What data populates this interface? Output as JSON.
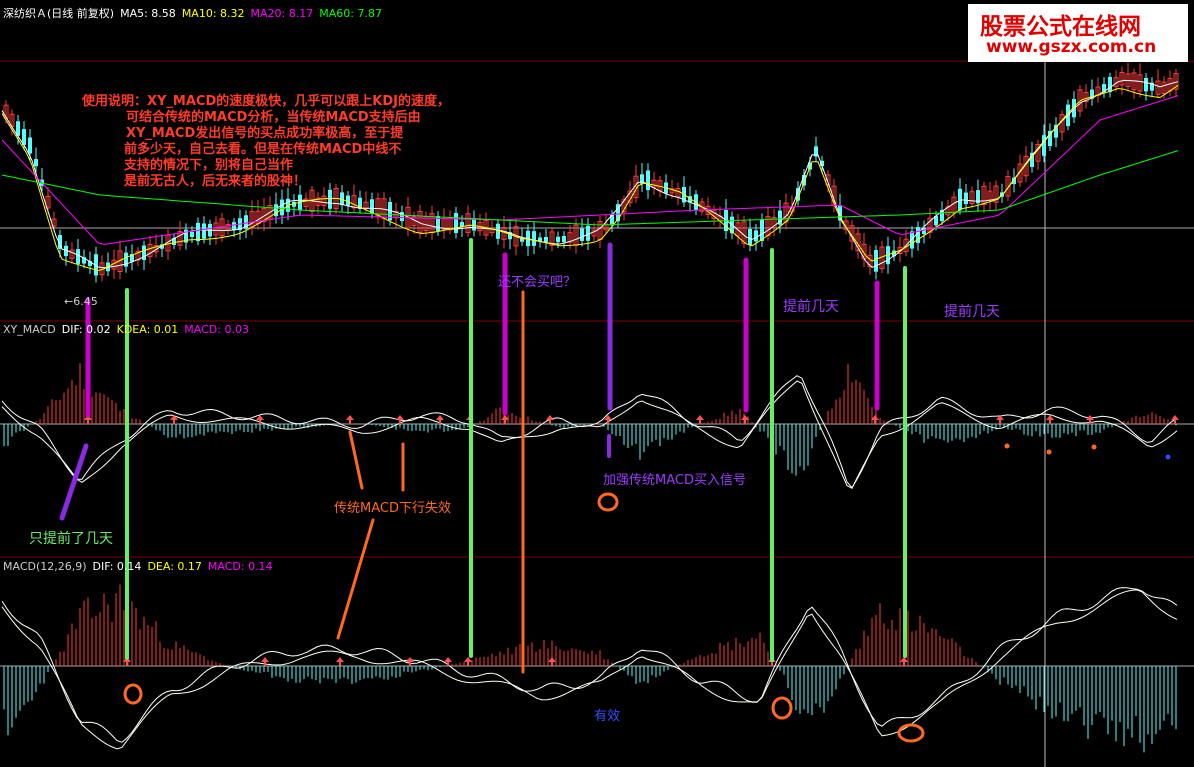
{
  "header": {
    "security": "深纺织Ａ(日线 前复权)",
    "ma5": "MA5: 8.58",
    "ma10": "MA10: 8.32",
    "ma20": "MA20: 8.17",
    "ma60": "MA60: 7.87"
  },
  "xy_header": {
    "name": "XY_MACD",
    "dif": "DIF: 0.02",
    "dea": "KDEA: 0.01",
    "macd": "MACD: 0.03"
  },
  "macd_header": {
    "name": "MACD(12,26,9)",
    "dif": "DIF: 0.14",
    "dea": "DEA: 0.17",
    "macd": "MACD: 0.14"
  },
  "price_low_label": "←6.45",
  "usage_note": [
    "使用说明：XY_MACD的速度极快，几乎可以跟上KDJ的速度，",
    "可结合传统的MACD分析，当传统MACD支持后由",
    "XY_MACD发出信号的买点成功率极高，至于提",
    "前多少天，自己去看。但是在传统MACD中线不",
    "支持的情况下，别将自己当作",
    "是前无古人，后无来者的股神！"
  ],
  "annotations": {
    "cant_buy": "还不会买吧？",
    "days_early_1": "提前几天",
    "days_early_2": "提前几天",
    "only_few_days": "只提前了几天",
    "traditional_fail": "传统MACD下行失效",
    "strengthen": "加强传统MACD买入信号",
    "effective": "有效"
  },
  "watermark": {
    "title": "股票公式在线网",
    "url": "www.gszx.com.cn"
  },
  "colors": {
    "background": "#000000",
    "up": "#ff3c3c",
    "down": "#54ffff",
    "ma5": "#ffffff",
    "ma10": "#ffff00",
    "ma20": "#ff00ff",
    "ma60": "#00ff00",
    "divider": "#800000",
    "green_marker": "#66ee66",
    "magenta_marker": "#cc00cc",
    "purple_marker": "#8a2be2",
    "orange_marker": "#ff6a1e"
  },
  "chart_data": [
    {
      "type": "candlestick",
      "title": "深纺织Ａ(日线 前复权)",
      "series": [
        {
          "name": "MA5",
          "value": 8.58
        },
        {
          "name": "MA10",
          "value": 8.32
        },
        {
          "name": "MA20",
          "value": 8.17
        },
        {
          "name": "MA60",
          "value": 7.87
        }
      ],
      "min_marked": 6.45
    },
    {
      "type": "bar+line",
      "title": "XY_MACD",
      "series": [
        {
          "name": "DIF",
          "value": 0.02
        },
        {
          "name": "KDEA",
          "value": 0.01
        },
        {
          "name": "MACD",
          "value": 0.03
        }
      ]
    },
    {
      "type": "bar+line",
      "title": "MACD(12,26,9)",
      "series": [
        {
          "name": "DIF",
          "value": 0.14
        },
        {
          "name": "DEA",
          "value": 0.17
        },
        {
          "name": "MACD",
          "value": 0.14
        }
      ]
    }
  ]
}
